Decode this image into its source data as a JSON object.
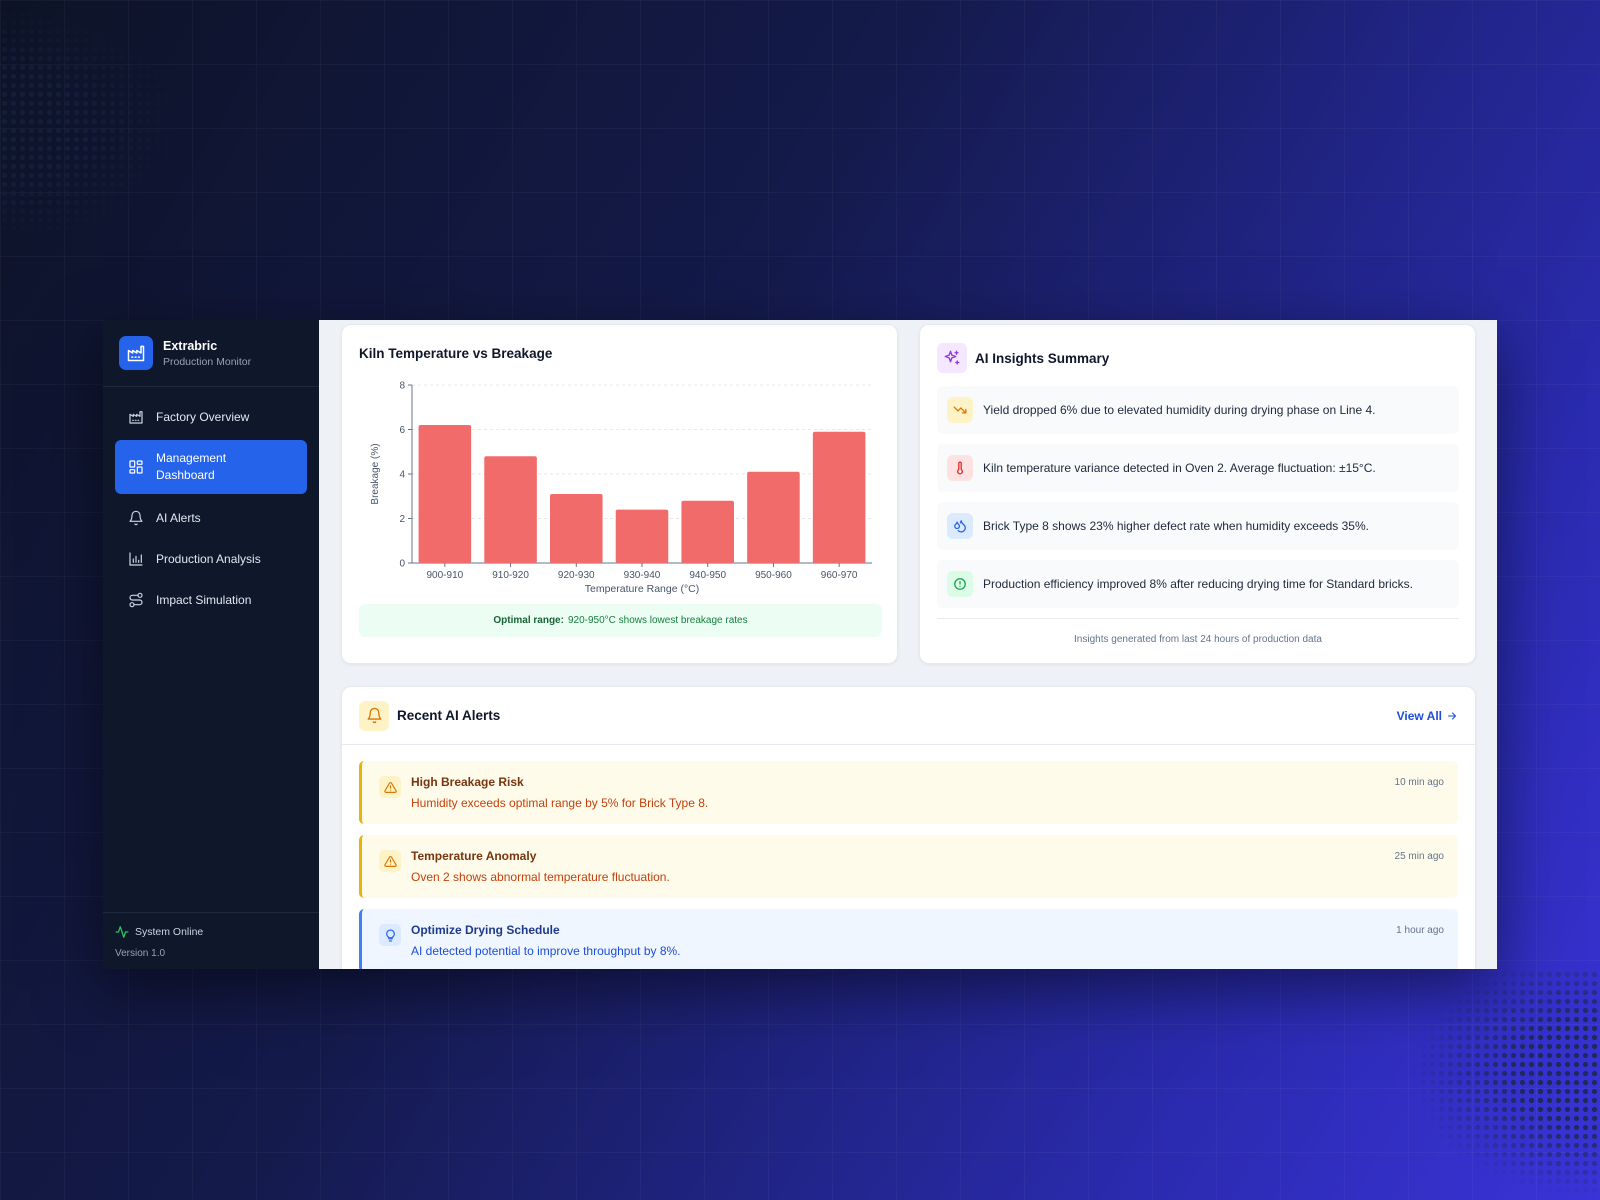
{
  "sidebar": {
    "brand_name": "Extrabric",
    "brand_subtitle": "Production Monitor",
    "items": [
      {
        "label": "Factory Overview",
        "icon": "factory-chart-icon"
      },
      {
        "label": "Management Dashboard",
        "icon": "dashboard-grid-icon"
      },
      {
        "label": "AI Alerts",
        "icon": "bell-icon"
      },
      {
        "label": "Production Analysis",
        "icon": "bar-chart-icon"
      },
      {
        "label": "Impact Simulation",
        "icon": "route-icon"
      }
    ],
    "status": "System Online",
    "version": "Version 1.0"
  },
  "chart_card": {
    "title": "Kiln Temperature vs Breakage",
    "optimal_label": "Optimal range:",
    "optimal_text": "920-950°C shows lowest breakage rates"
  },
  "chart_data": {
    "type": "bar",
    "title": "Kiln Temperature vs Breakage",
    "categories": [
      "900-910",
      "910-920",
      "920-930",
      "930-940",
      "940-950",
      "950-960",
      "960-970"
    ],
    "values": [
      6.2,
      4.8,
      3.1,
      2.4,
      2.8,
      4.1,
      5.9
    ],
    "xlabel": "Temperature Range (°C)",
    "ylabel": "Breakage (%)",
    "ylim": [
      0,
      8
    ],
    "yticks": [
      0,
      2,
      4,
      6,
      8
    ],
    "grid": true,
    "bar_color": "#f26b6b"
  },
  "insights": {
    "title": "AI Insights Summary",
    "items": [
      {
        "text": "Yield dropped 6% due to elevated humidity during drying phase on Line 4.",
        "icon": "trending-down-icon",
        "bg": "#fef3c7",
        "fg": "#d97706"
      },
      {
        "text": "Kiln temperature variance detected in Oven 2. Average fluctuation: ±15°C.",
        "icon": "thermometer-icon",
        "bg": "#fee2e2",
        "fg": "#dc2626"
      },
      {
        "text": "Brick Type 8 shows 23% higher defect rate when humidity exceeds 35%.",
        "icon": "droplets-icon",
        "bg": "#dbeafe",
        "fg": "#2563eb"
      },
      {
        "text": "Production efficiency improved 8% after reducing drying time for Standard bricks.",
        "icon": "check-circle-icon",
        "bg": "#dcfce7",
        "fg": "#16a34a"
      }
    ],
    "footer": "Insights generated from last 24 hours of production data"
  },
  "alerts": {
    "title": "Recent AI Alerts",
    "view_all": "View All",
    "items": [
      {
        "title": "High Breakage Risk",
        "message": "Humidity exceeds optimal range by 5% for Brick Type 8.",
        "time": "10 min ago",
        "kind": "warning",
        "icon": "warning-triangle-icon"
      },
      {
        "title": "Temperature Anomaly",
        "message": "Oven 2 shows abnormal temperature fluctuation.",
        "time": "25 min ago",
        "kind": "warning",
        "icon": "warning-triangle-icon"
      },
      {
        "title": "Optimize Drying Schedule",
        "message": "AI detected potential to improve throughput by 8%.",
        "time": "1 hour ago",
        "kind": "info",
        "icon": "lightbulb-icon"
      }
    ]
  },
  "colors": {
    "accent": "#2563eb",
    "sidebar_bg": "#0f172a",
    "warning": "#eab308",
    "info": "#3b82f6",
    "online": "#22c55e"
  }
}
